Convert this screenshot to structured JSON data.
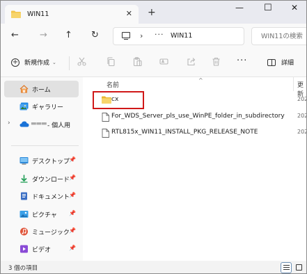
{
  "window": {
    "tab_title": "WIN11",
    "tab_close": "✕",
    "new_tab": "+",
    "minimize": "—",
    "maximize": "☐",
    "close": "✕"
  },
  "nav": {
    "back": "←",
    "forward": "→",
    "up": "↑",
    "refresh": "↻"
  },
  "address": {
    "separator": "›",
    "ellipsis": "···",
    "current": "WIN11",
    "search_placeholder": "WIN11の検索"
  },
  "toolbar": {
    "new_label": "新規作成",
    "new_chevron": "⌄",
    "more": "···",
    "details_label": "詳細",
    "icons": [
      "cut-icon",
      "copy-icon",
      "paste-icon",
      "rename-icon",
      "share-icon",
      "delete-icon"
    ]
  },
  "sidebar": {
    "items": [
      {
        "label": "ホーム",
        "icon": "home-icon",
        "pinned": false
      },
      {
        "label": "ギャラリー",
        "icon": "gallery-icon",
        "pinned": false
      },
      {
        "label": "- 個人用",
        "icon": "onedrive-icon",
        "pinned": false,
        "expander": "›"
      },
      {
        "label": "デスクトップ",
        "icon": "desktop-icon",
        "pinned": true
      },
      {
        "label": "ダウンロード",
        "icon": "download-icon",
        "pinned": true
      },
      {
        "label": "ドキュメント",
        "icon": "document-icon",
        "pinned": true
      },
      {
        "label": "ピクチャ",
        "icon": "pictures-icon",
        "pinned": true
      },
      {
        "label": "ミュージック",
        "icon": "music-icon",
        "pinned": true
      },
      {
        "label": "ビデオ",
        "icon": "video-icon",
        "pinned": true
      }
    ],
    "pin_glyph": "📌"
  },
  "main": {
    "columns": {
      "name": "名前",
      "date": "更新"
    },
    "sort_indicator": "^",
    "files": [
      {
        "name": "cx",
        "type": "folder",
        "date": "202"
      },
      {
        "name": "For_WDS_Server_pls_use_WinPE_folder_in_subdirectory",
        "type": "file",
        "date": "202"
      },
      {
        "name": "RTL815x_WIN11_INSTALL_PKG_RELEASE_NOTE",
        "type": "file",
        "date": "202"
      }
    ]
  },
  "status": {
    "item_count": "3 個の項目"
  },
  "colors": {
    "folder": "#f2c34a",
    "highlight": "#d01818",
    "onedrive": "#1a73d8",
    "music": "#e0553a",
    "video": "#8a4bd6"
  }
}
